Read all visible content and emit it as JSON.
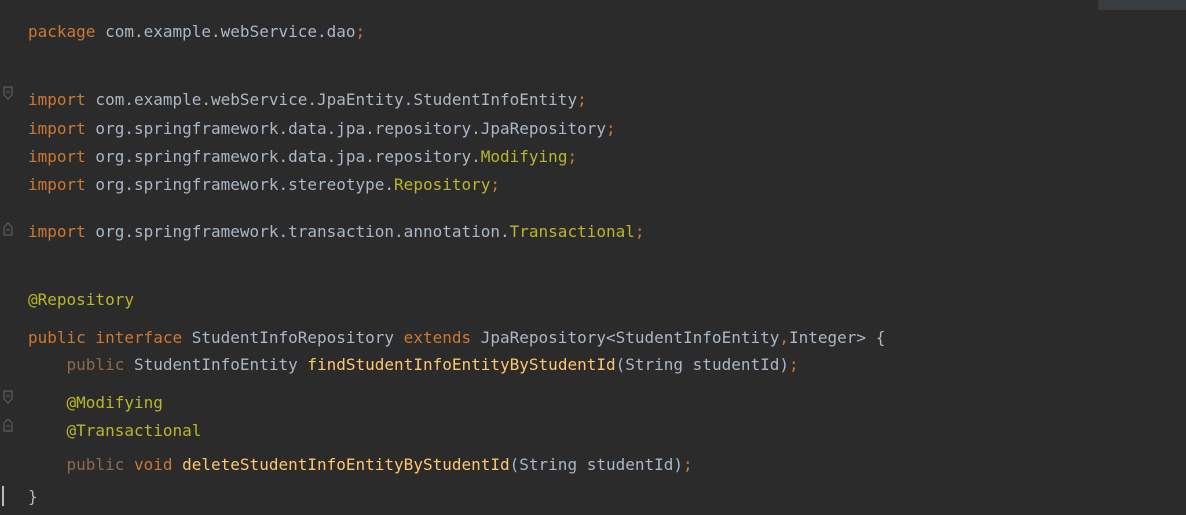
{
  "colors": {
    "background": "#2b2b2b",
    "keyword": "#cc7832",
    "text": "#a9b7c6",
    "annotation": "#bbb529",
    "method": "#ffc66d",
    "dim_keyword": "#8a6b4e",
    "gutter_fold": "#595b5d"
  },
  "code": {
    "line_1": {
      "kw": "package",
      "text": " com.example.webService.dao",
      "semi": ";"
    },
    "line_3": {
      "kw": "import",
      "text": " com.example.webService.JpaEntity.StudentInfoEntity",
      "semi": ";"
    },
    "line_4": {
      "kw": "import",
      "text": " org.springframework.data.jpa.repository.JpaRepository",
      "semi": ";"
    },
    "line_5": {
      "kw": "import",
      "text": " org.springframework.data.jpa.repository.",
      "ident": "Modifying",
      "semi": ";"
    },
    "line_6": {
      "kw": "import",
      "text": " org.springframework.stereotype.",
      "ident": "Repository",
      "semi": ";"
    },
    "line_7": {
      "kw": "import",
      "text": " org.springframework.transaction.annotation.",
      "ident": "Transactional",
      "semi": ";"
    },
    "line_9": {
      "annotation": "@Repository"
    },
    "line_10": {
      "kw1": "public",
      "kw2": " interface",
      "text1": " StudentInfoRepository",
      "kw3": " extends",
      "text2": " JpaRepository<StudentInfoEntity",
      "comma": ",",
      "text3": "Integer> {"
    },
    "line_11": {
      "indent": "    ",
      "kw": "public",
      "text1": " StudentInfoEntity ",
      "method": "findStudentInfoEntityByStudentId",
      "text2": "(String studentId)",
      "semi": ";"
    },
    "line_12": {
      "indent": "    ",
      "annotation": "@Modifying"
    },
    "line_13": {
      "indent": "    ",
      "annotation": "@Transactional"
    },
    "line_14": {
      "indent": "    ",
      "kw1": "public",
      "kw2": " void ",
      "method": "deleteStudentInfoEntityByStudentId",
      "text": "(String studentId)",
      "semi": ";"
    },
    "line_15": {
      "text": "}"
    }
  },
  "icons": {
    "fold_open": "fold-open-icon",
    "fold_close": "fold-close-icon"
  }
}
